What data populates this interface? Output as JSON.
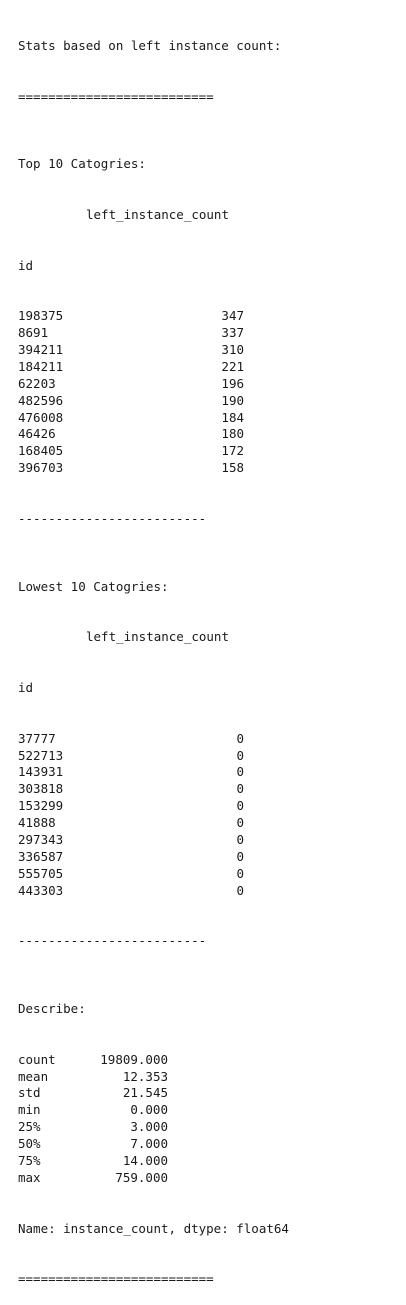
{
  "output": {
    "title": "Stats based on left instance count:",
    "sep_double": "==========================",
    "sep_single": "-------------------------",
    "top": {
      "heading": "Top 10 Catogries:",
      "column_header": "left_instance_count",
      "index_name": "id",
      "rows": [
        {
          "id": "198375",
          "value": "347"
        },
        {
          "id": "8691",
          "value": "337"
        },
        {
          "id": "394211",
          "value": "310"
        },
        {
          "id": "184211",
          "value": "221"
        },
        {
          "id": "62203",
          "value": "196"
        },
        {
          "id": "482596",
          "value": "190"
        },
        {
          "id": "476008",
          "value": "184"
        },
        {
          "id": "46426",
          "value": "180"
        },
        {
          "id": "168405",
          "value": "172"
        },
        {
          "id": "396703",
          "value": "158"
        }
      ]
    },
    "lowest": {
      "heading": "Lowest 10 Catogries:",
      "column_header": "left_instance_count",
      "index_name": "id",
      "rows": [
        {
          "id": "37777",
          "value": "0"
        },
        {
          "id": "522713",
          "value": "0"
        },
        {
          "id": "143931",
          "value": "0"
        },
        {
          "id": "303818",
          "value": "0"
        },
        {
          "id": "153299",
          "value": "0"
        },
        {
          "id": "41888",
          "value": "0"
        },
        {
          "id": "297343",
          "value": "0"
        },
        {
          "id": "336587",
          "value": "0"
        },
        {
          "id": "555705",
          "value": "0"
        },
        {
          "id": "443303",
          "value": "0"
        }
      ]
    },
    "describe": {
      "heading": "Describe:",
      "rows": [
        {
          "stat": "count",
          "value": "19809.000"
        },
        {
          "stat": "mean",
          "value": "12.353"
        },
        {
          "stat": "std",
          "value": "21.545"
        },
        {
          "stat": "min",
          "value": "0.000"
        },
        {
          "stat": "25%",
          "value": "3.000"
        },
        {
          "stat": "50%",
          "value": "7.000"
        },
        {
          "stat": "75%",
          "value": "14.000"
        },
        {
          "stat": "max",
          "value": "759.000"
        }
      ],
      "footer": "Name: instance_count, dtype: float64"
    }
  }
}
